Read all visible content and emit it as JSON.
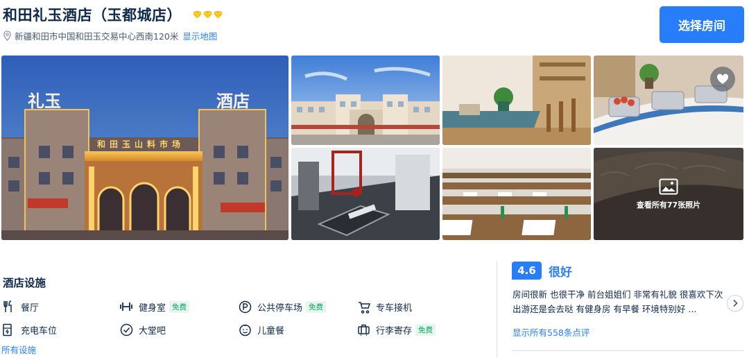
{
  "header": {
    "hotel_name": "和田礼玉酒店（玉都城店）",
    "address": "新疆和田市中国和田玉交易中心西南120米",
    "map_link": "显示地图",
    "select_room_button": "选择房间",
    "diamond_count": 3,
    "accent_color": "#287dfa",
    "diamond_color": "#f5b800"
  },
  "gallery": {
    "photos": [
      {
        "subject": "hotel-facade",
        "signs": [
          "礼玉",
          "酒店",
          "和田玉山料市场"
        ]
      },
      {
        "subject": "street-view"
      },
      {
        "subject": "dining-area"
      },
      {
        "subject": "breakfast-buffet"
      },
      {
        "subject": "gym"
      },
      {
        "subject": "meeting-room"
      },
      {
        "subject": "lobby-mural"
      }
    ],
    "view_all_label": "查看所有77张照片",
    "favorite_icon": "heart-icon"
  },
  "facilities": {
    "title": "酒店设施",
    "items": [
      {
        "label": "餐厅",
        "icon": "restaurant-icon",
        "free": ""
      },
      {
        "label": "健身室",
        "icon": "dumbbell-icon",
        "free": "免费"
      },
      {
        "label": "公共停车场",
        "icon": "parking-icon",
        "free": "免费"
      },
      {
        "label": "专车接机",
        "icon": "airport-shuttle-icon",
        "free": ""
      },
      {
        "label": "充电车位",
        "icon": "ev-charging-icon",
        "free": ""
      },
      {
        "label": "大堂吧",
        "icon": "check-circle-icon",
        "free": ""
      },
      {
        "label": "儿童餐",
        "icon": "kids-meal-icon",
        "free": ""
      },
      {
        "label": "行李寄存",
        "icon": "luggage-icon",
        "free": "免费"
      }
    ],
    "all_link": "所有设施"
  },
  "review": {
    "score": "4.6",
    "rating_word": "很好",
    "text": "房间很新 也很干净 前台姐姐们 非常有礼貌 很喜欢下次出游还是会去哒 有健身房 有早餐 环境特别好 ...",
    "all_reviews_link": "显示所有558条点评"
  }
}
